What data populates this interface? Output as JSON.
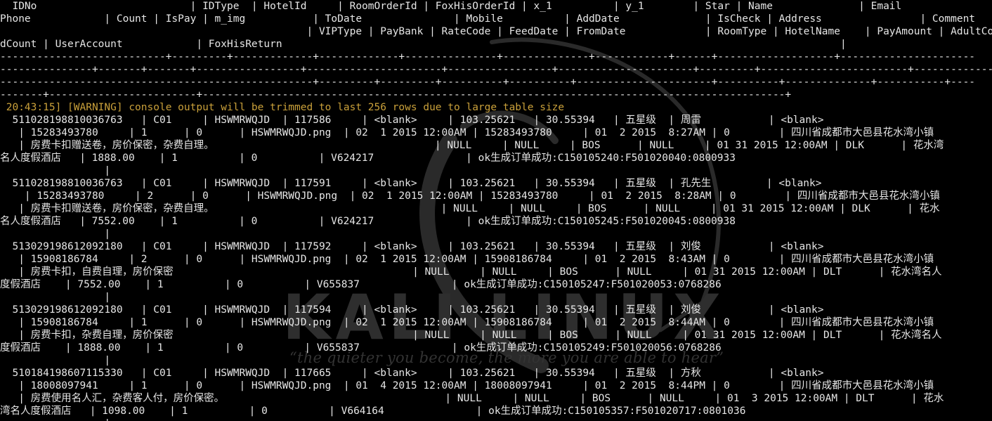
{
  "colors": {
    "background": "#000000",
    "text": "#e6e6e6",
    "warning": "#c9a03a",
    "watermark": "#3a3a3a"
  },
  "watermark": {
    "logo_text": "KALI LINUX",
    "tagline": "“the quieter you become, the more you are able to hear”"
  },
  "terminal": {
    "lines": [
      "  IDNo                         | IDType  | HotelId     | RoomOrderId | FoxHisOrderId | x_1          | y_1        | Star | Name              | Email",
      "Phone            | Count | IsPay | m_img           | ToDate               | Mobile          | AddDate              | IsCheck | Address                | Comment",
      "                                                  | VIPType | PayBank | RateCode | FeedDate | FromDate             | RoomType | HotelName    | PayAmount | AdultCount | Chil",
      "dCount | UserAccount            | FoxHisReturn                                                                                           |",
      "---------------------------+---------+-------------+-------------+---------------+--------------+------------+------+-------------------+----------------------",
      "---------------+-------+-------+-----------------+----------------------+-----------------+----------------------+---------+------------------------+-------------",
      "---------------------------------------------------+---------+---------+----------+----------+----------------------+----------+--------------+-----------+----",
      "-------+------------------------+-----------------------------------------------------------------------------------------------+",
      " 20:43:15] [WARNING] console output will be trimmed to last 256 rows due to large table size",
      "  511028198810036763   | C01     | HSWMRWQJD  | 117586     | <blank>     | 103.25621   | 30.55394   | 五星级  | 周雷           | <blank>",
      "   | 15283493780     | 1      | 0      | HSWMRWQJD.png  | 02  1 2015 12:00AM | 15283493780     | 01  2 2015  8:27AM | 0        | 四川省成都市大邑县花水湾小镇",
      "   | 房费卡扣赠送卷，房价保密，杂费自理。                                    | NULL     | NULL     | BOS      | NULL     | 01 31 2015 12:00AM | DLK      | 花水湾",
      "名人度假酒店   | 1888.00    | 1          | 0          | V624217               | ok生成订单成功:C150105240:F501020040:0800933",
      "                 |",
      "  511028198810036763   | C01     | HSWMRWQJD  | 117591     | <blank>     | 103.25621   | 30.55394   | 五星级  | 孔先生         | <blank>",
      "    | 15283493780     | 2      | 0      | HSWMRWQJD.png  | 02  1 2015 12:00AM | 15283493780     | 01  2 2015  8:28AM | 0        | 四川省成都市大邑县花水湾小镇",
      "   | 房费卡扣赠送卷，房价保密，杂费自理。                                     | NULL     | NULL     | BOS      | NULL     | 01 31 2015 12:00AM | DLK      | 花水",
      "名人度假酒店   | 7552.00    | 1          | 0          | V624217               | ok生成订单成功:C150105245:F501020045:0800938",
      "                 |",
      "  513029198612092180   | C01     | HSWMRWQJD  | 117592     | <blank>     | 103.25621   | 30.55394   | 五星级  | 刘俊           | <blank>",
      "   | 15908186784     | 2      | 0      | HSWMRWQJD.png  | 02  1 2015 12:00AM | 15908186784     | 01  2 2015  8:43AM | 0        | 四川省成都市大邑县花水湾小镇",
      "   | 房费卡扣，自费自理，房价保密                                       | NULL     | NULL     | BOS      | NULL     | 01 31 2015 12:00AM | DLT      | 花水湾名人",
      "度假酒店    | 7552.00    | 1          | 0          | V655837               | ok生成订单成功:C150105247:F501020053:0768286",
      "                 |",
      "  513029198612092180   | C01     | HSWMRWQJD  | 117594     | <blank>     | 103.25621   | 30.55394   | 五星级  | 刘俊           | <blank>",
      "   | 15908186784     | 1      | 0      | HSWMRWQJD.png  | 02  1 2015 12:00AM | 15908186784     | 01  2 2015  8:44AM | 0        | 四川省成都市大邑县花水湾小镇",
      "   | 房费卡扣，杂费自理，房价保密                                       | NULL     | NULL     | BOS      | NULL     | 01 31 2015 12:00AM | DLT      | 花水湾名人",
      "度假酒店    | 1888.00    | 1          | 0          | V655837               | ok生成订单成功:C150105249:F501020056:0768286",
      "                 |",
      "  510184198607115330   | C01     | HSWMRWQJD  | 117665     | <blank>     | 103.25621   | 30.55394   | 五星级  | 方秋           | <blank>",
      "   | 18008097941     | 1      | 0      | HSWMRWQJD.png  | 01  4 2015 12:00AM | 18008097941     | 01  2 2015  8:44PM | 0        | 四川省成都市大邑县花水湾小镇",
      "   | 房费使用名人汇，杂费客人付，房价保密。                                    | NULL     | NULL     | BOS      | NULL     | 01  3 2015 12:00AM | DLT      | 花水",
      "湾名人度假酒店   | 1098.00    | 1          | 0          | V664164               | ok生成订单成功:C150105357:F501020717:0801036",
      "                 |"
    ]
  }
}
